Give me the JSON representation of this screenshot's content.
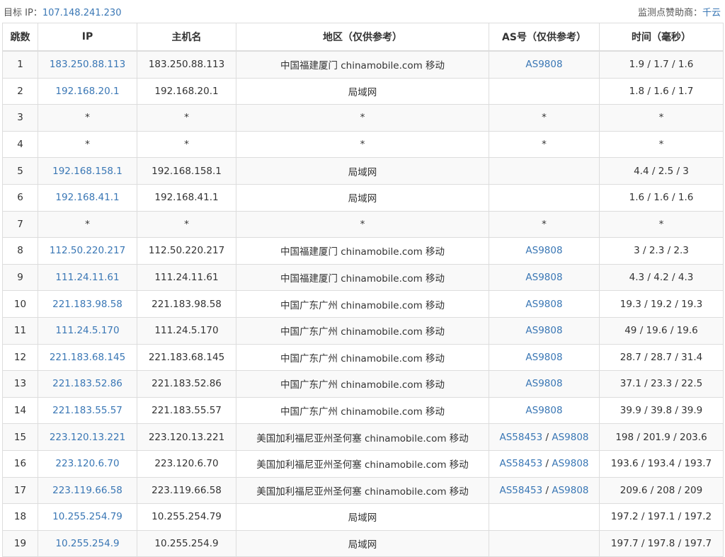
{
  "header": {
    "target_label": "目标 IP：",
    "target_ip": "107.148.241.230",
    "sponsor_label": "监测点赞助商：",
    "sponsor_name": "千云"
  },
  "table": {
    "columns": [
      "跳数",
      "IP",
      "主机名",
      "地区（仅供参考）",
      "AS号（仅供参考）",
      "时间（毫秒）"
    ],
    "rows": [
      {
        "hop": "1",
        "ip": "183.250.88.113",
        "host": "183.250.88.113",
        "region": "中国福建厦门 chinamobile.com 移动",
        "as": [
          "AS9808"
        ],
        "time": "1.9 / 1.7 / 1.6"
      },
      {
        "hop": "2",
        "ip": "192.168.20.1",
        "host": "192.168.20.1",
        "region": "局域网",
        "as": [],
        "time": "1.8 / 1.6 / 1.7"
      },
      {
        "hop": "3",
        "ip": "*",
        "host": "*",
        "region": "*",
        "as": [
          "*"
        ],
        "time": "*"
      },
      {
        "hop": "4",
        "ip": "*",
        "host": "*",
        "region": "*",
        "as": [
          "*"
        ],
        "time": "*"
      },
      {
        "hop": "5",
        "ip": "192.168.158.1",
        "host": "192.168.158.1",
        "region": "局域网",
        "as": [],
        "time": "4.4 / 2.5 / 3"
      },
      {
        "hop": "6",
        "ip": "192.168.41.1",
        "host": "192.168.41.1",
        "region": "局域网",
        "as": [],
        "time": "1.6 / 1.6 / 1.6"
      },
      {
        "hop": "7",
        "ip": "*",
        "host": "*",
        "region": "*",
        "as": [
          "*"
        ],
        "time": "*"
      },
      {
        "hop": "8",
        "ip": "112.50.220.217",
        "host": "112.50.220.217",
        "region": "中国福建厦门 chinamobile.com 移动",
        "as": [
          "AS9808"
        ],
        "time": "3 / 2.3 / 2.3"
      },
      {
        "hop": "9",
        "ip": "111.24.11.61",
        "host": "111.24.11.61",
        "region": "中国福建厦门 chinamobile.com 移动",
        "as": [
          "AS9808"
        ],
        "time": "4.3 / 4.2 / 4.3"
      },
      {
        "hop": "10",
        "ip": "221.183.98.58",
        "host": "221.183.98.58",
        "region": "中国广东广州 chinamobile.com 移动",
        "as": [
          "AS9808"
        ],
        "time": "19.3 / 19.2 / 19.3"
      },
      {
        "hop": "11",
        "ip": "111.24.5.170",
        "host": "111.24.5.170",
        "region": "中国广东广州 chinamobile.com 移动",
        "as": [
          "AS9808"
        ],
        "time": "49 / 19.6 / 19.6"
      },
      {
        "hop": "12",
        "ip": "221.183.68.145",
        "host": "221.183.68.145",
        "region": "中国广东广州 chinamobile.com 移动",
        "as": [
          "AS9808"
        ],
        "time": "28.7 / 28.7 / 31.4"
      },
      {
        "hop": "13",
        "ip": "221.183.52.86",
        "host": "221.183.52.86",
        "region": "中国广东广州 chinamobile.com 移动",
        "as": [
          "AS9808"
        ],
        "time": "37.1 / 23.3 / 22.5"
      },
      {
        "hop": "14",
        "ip": "221.183.55.57",
        "host": "221.183.55.57",
        "region": "中国广东广州 chinamobile.com 移动",
        "as": [
          "AS9808"
        ],
        "time": "39.9 / 39.8 / 39.9"
      },
      {
        "hop": "15",
        "ip": "223.120.13.221",
        "host": "223.120.13.221",
        "region": "美国加利福尼亚州圣何塞 chinamobile.com 移动",
        "as": [
          "AS58453",
          "AS9808"
        ],
        "time": "198 / 201.9 / 203.6"
      },
      {
        "hop": "16",
        "ip": "223.120.6.70",
        "host": "223.120.6.70",
        "region": "美国加利福尼亚州圣何塞 chinamobile.com 移动",
        "as": [
          "AS58453",
          "AS9808"
        ],
        "time": "193.6 / 193.4 / 193.7"
      },
      {
        "hop": "17",
        "ip": "223.119.66.58",
        "host": "223.119.66.58",
        "region": "美国加利福尼亚州圣何塞 chinamobile.com 移动",
        "as": [
          "AS58453",
          "AS9808"
        ],
        "time": "209.6 / 208 / 209"
      },
      {
        "hop": "18",
        "ip": "10.255.254.79",
        "host": "10.255.254.79",
        "region": "局域网",
        "as": [],
        "time": "197.2 / 197.1 / 197.2"
      },
      {
        "hop": "19",
        "ip": "10.255.254.9",
        "host": "10.255.254.9",
        "region": "局域网",
        "as": [],
        "time": "197.7 / 197.8 / 197.7"
      }
    ]
  },
  "colors": {
    "link": "#3a77b5",
    "text": "#333333",
    "border": "#dddddd",
    "row_alt": "#f9f9f9"
  }
}
